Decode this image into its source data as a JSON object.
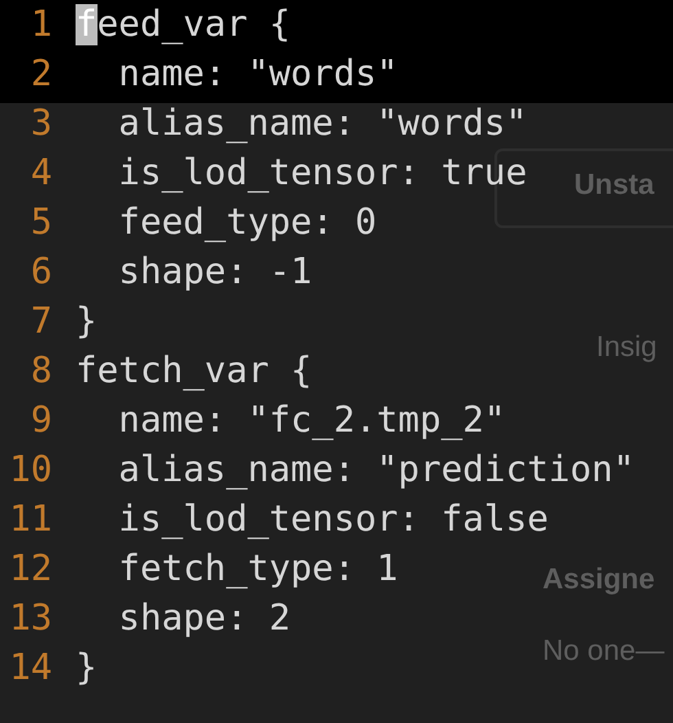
{
  "background_page": {
    "star_button": "Unsta",
    "insights_tab": "Insig",
    "assignees_heading": "Assigne",
    "assignees_value": "No one—"
  },
  "editor": {
    "lines": [
      {
        "number": "1",
        "text": "feed_var {",
        "cursor": true
      },
      {
        "number": "2",
        "text": "  name: \"words\""
      },
      {
        "number": "3",
        "text": "  alias_name: \"words\""
      },
      {
        "number": "4",
        "text": "  is_lod_tensor: true"
      },
      {
        "number": "5",
        "text": "  feed_type: 0"
      },
      {
        "number": "6",
        "text": "  shape: -1"
      },
      {
        "number": "7",
        "text": "}"
      },
      {
        "number": "8",
        "text": "fetch_var {"
      },
      {
        "number": "9",
        "text": "  name: \"fc_2.tmp_2\""
      },
      {
        "number": "10",
        "text": "  alias_name: \"prediction\""
      },
      {
        "number": "11",
        "text": "  is_lod_tensor: false"
      },
      {
        "number": "12",
        "text": "  fetch_type: 1"
      },
      {
        "number": "13",
        "text": "  shape: 2"
      },
      {
        "number": "14",
        "text": "}"
      }
    ]
  }
}
